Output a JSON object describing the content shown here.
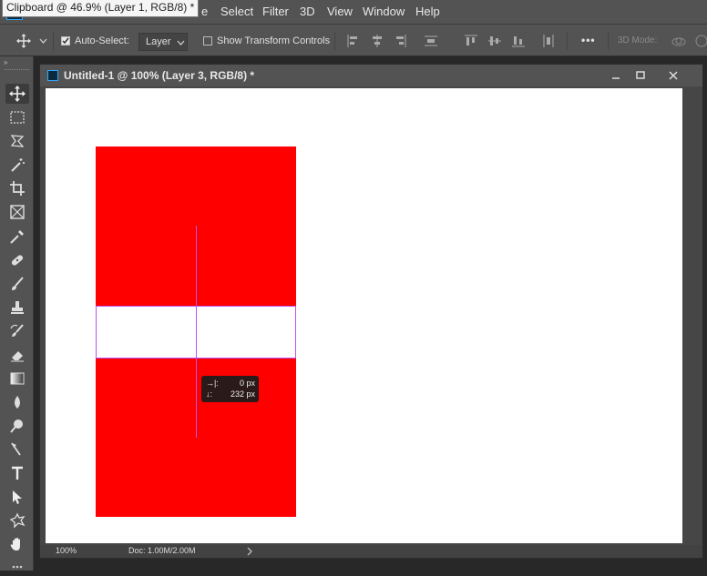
{
  "menu": {
    "tooltip": "Clipboard @ 46.9% (Layer 1, RGB/8) *",
    "visible_fragments": [
      "e",
      "Select",
      "Filter",
      "3D",
      "View",
      "Window",
      "Help"
    ]
  },
  "options": {
    "auto_select_label": "Auto-Select:",
    "auto_select_checked": true,
    "target_value": "Layer",
    "show_transform_label": "Show Transform Controls",
    "show_transform_checked": false,
    "more_label": "•••",
    "mode_label": "3D Mode:"
  },
  "tools": [
    "move-tool",
    "marquee-tool",
    "lasso-tool",
    "magic-wand-tool",
    "crop-tool",
    "frame-tool",
    "eyedropper-tool",
    "healing-brush-tool",
    "brush-tool",
    "clone-stamp-tool",
    "history-brush-tool",
    "eraser-tool",
    "gradient-tool",
    "blur-tool",
    "dodge-tool",
    "pen-tool",
    "type-tool",
    "path-selection-tool",
    "shape-tool",
    "hand-tool"
  ],
  "document": {
    "title": "Untitled-1 @ 100% (Layer 3, RGB/8) *",
    "zoom": "100%",
    "doc_info": "Doc: 1.00M/2.00M",
    "measure": {
      "dx_label": "→|:",
      "dx_value": "0 px",
      "dy_label": "↓:",
      "dy_value": "232 px"
    }
  },
  "colors": {
    "ui_panel": "#535353",
    "canvas": "#ffffff",
    "shape_fill": "#ff0000",
    "guide": "#c050f0"
  }
}
